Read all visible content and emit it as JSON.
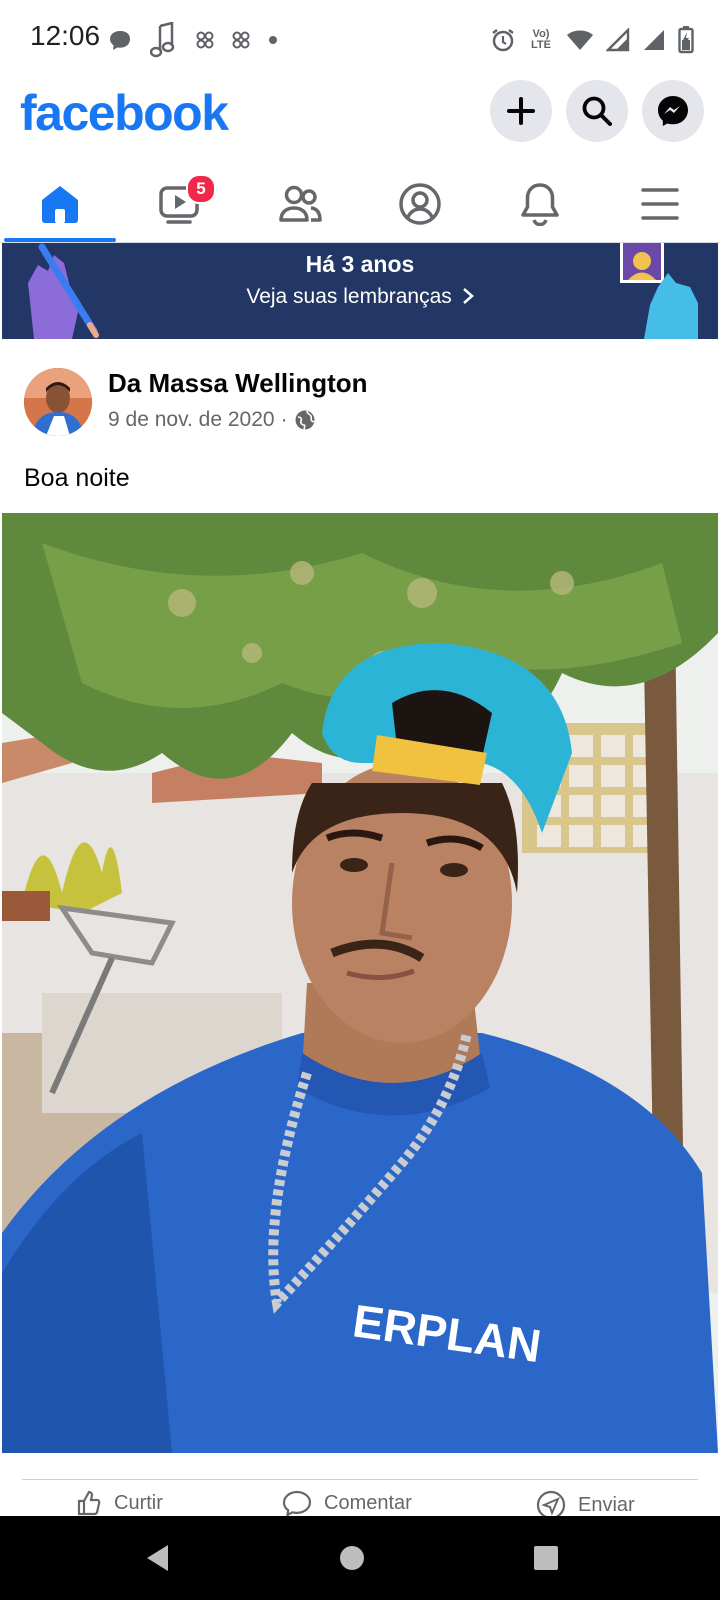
{
  "status_bar": {
    "time": "12:06",
    "left_icons": [
      "chat-bubble-icon",
      "music-note-icon",
      "app-icon",
      "app-icon",
      "dot-icon"
    ],
    "right_icons": [
      "alarm-icon",
      "volte-icon",
      "wifi-icon",
      "signal-icon",
      "signal-icon",
      "battery-icon"
    ],
    "volte_label": "Vo) LTE"
  },
  "header": {
    "logo": "facebook",
    "brand_color": "#1877f2"
  },
  "tabs": [
    {
      "name": "home",
      "icon": "home-icon",
      "active": true
    },
    {
      "name": "watch",
      "icon": "video-icon",
      "badge": "5"
    },
    {
      "name": "friends",
      "icon": "friends-icon"
    },
    {
      "name": "profile",
      "icon": "profile-icon"
    },
    {
      "name": "notifications",
      "icon": "bell-icon"
    },
    {
      "name": "menu",
      "icon": "menu-icon"
    }
  ],
  "memories": {
    "title": "Há 3 anos",
    "link": "Veja suas lembranças",
    "background": "#223765"
  },
  "post": {
    "author": "Da Massa Wellington",
    "date": "9 de nov. de 2020",
    "separator": "·",
    "privacy_icon": "globe-icon",
    "text": "Boa noite",
    "shirt_print": "ERPLAN"
  },
  "actions": [
    "Curtir",
    "Comentar",
    "Enviar"
  ]
}
